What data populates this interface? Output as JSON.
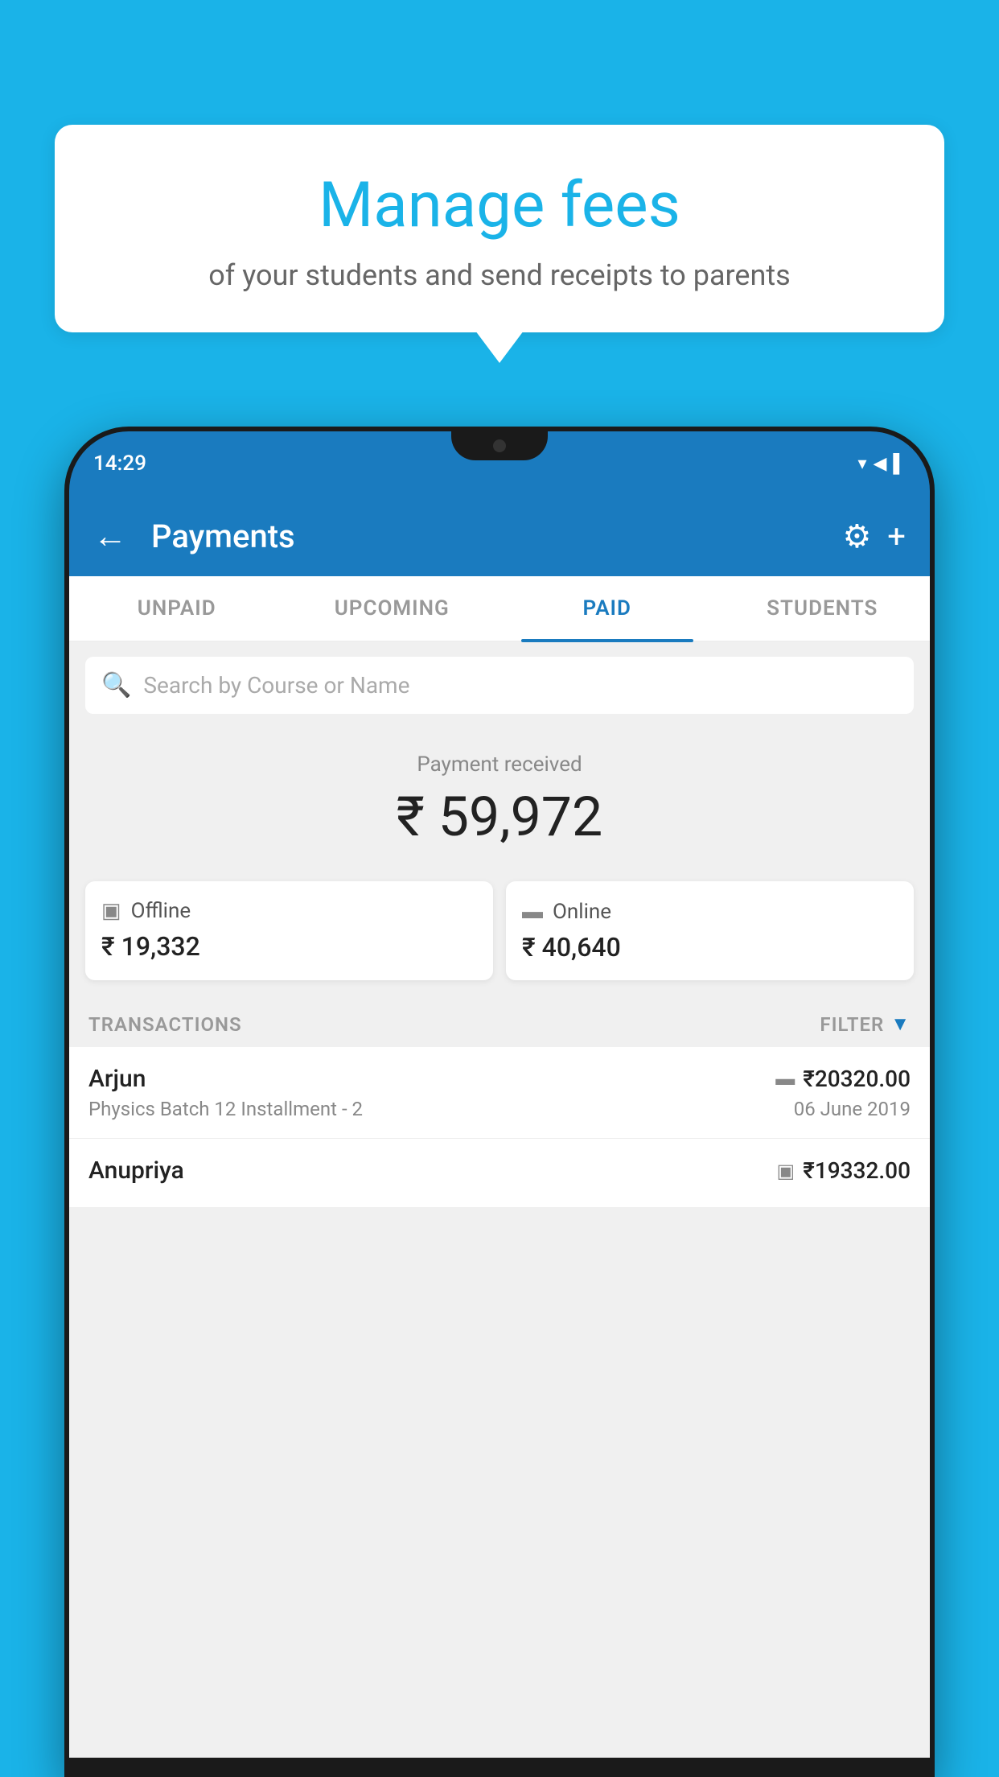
{
  "background_color": "#1ab3e8",
  "speech_bubble": {
    "title": "Manage fees",
    "subtitle": "of your students and send receipts to parents"
  },
  "status_bar": {
    "time": "14:29",
    "icons": "▼◀▌"
  },
  "app_bar": {
    "title": "Payments",
    "back_label": "←",
    "settings_icon": "⚙",
    "plus_icon": "+"
  },
  "tabs": [
    {
      "label": "UNPAID",
      "active": false
    },
    {
      "label": "UPCOMING",
      "active": false
    },
    {
      "label": "PAID",
      "active": true
    },
    {
      "label": "STUDENTS",
      "active": false
    }
  ],
  "search": {
    "placeholder": "Search by Course or Name"
  },
  "payment_received": {
    "label": "Payment received",
    "amount": "₹ 59,972"
  },
  "payment_cards": [
    {
      "label": "Offline",
      "amount": "₹ 19,332",
      "icon": "💳"
    },
    {
      "label": "Online",
      "amount": "₹ 40,640",
      "icon": "💳"
    }
  ],
  "transactions": {
    "section_label": "TRANSACTIONS",
    "filter_label": "FILTER",
    "items": [
      {
        "name": "Arjun",
        "course": "Physics Batch 12 Installment - 2",
        "amount": "₹20320.00",
        "date": "06 June 2019",
        "payment_type": "online"
      },
      {
        "name": "Anupriya",
        "course": "",
        "amount": "₹19332.00",
        "date": "",
        "payment_type": "offline"
      }
    ]
  }
}
